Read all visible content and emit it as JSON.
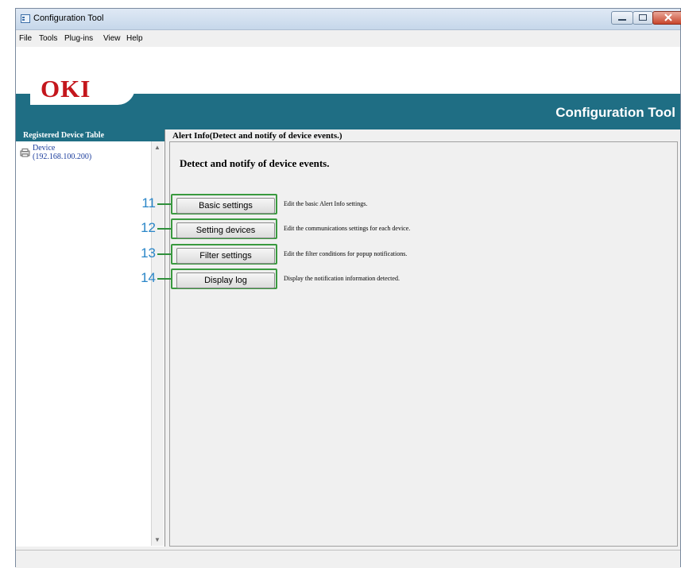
{
  "window": {
    "title": "Configuration Tool",
    "app_icon": "app-window-icon"
  },
  "menu": [
    "File",
    "Tools",
    "Plug-ins",
    "View",
    "Help"
  ],
  "banner": {
    "logo": "OKI",
    "title": "Configuration Tool"
  },
  "colors": {
    "banner": "#1f6e84",
    "logo_red": "#c4161c",
    "highlight_green": "#3a9a3f",
    "callout_blue": "#2a86c8",
    "device_link": "#1a3c9c"
  },
  "sidebar": {
    "header": "Registered Device Table",
    "device": {
      "name": "Device",
      "ip": "(192.168.100.200)",
      "icon": "printer-icon"
    }
  },
  "main": {
    "title": "Alert Info(Detect and notify of device events.)",
    "heading": "Detect and notify of device events.",
    "actions": [
      {
        "callout": "11",
        "label": "Basic settings",
        "desc": "Edit the basic Alert Info settings."
      },
      {
        "callout": "12",
        "label": "Setting devices",
        "desc": "Edit the communications settings for each device."
      },
      {
        "callout": "13",
        "label": "Filter settings",
        "desc": "Edit the filter conditions for popup notifications."
      },
      {
        "callout": "14",
        "label": "Display log",
        "desc": "Display the notification information detected."
      }
    ]
  }
}
